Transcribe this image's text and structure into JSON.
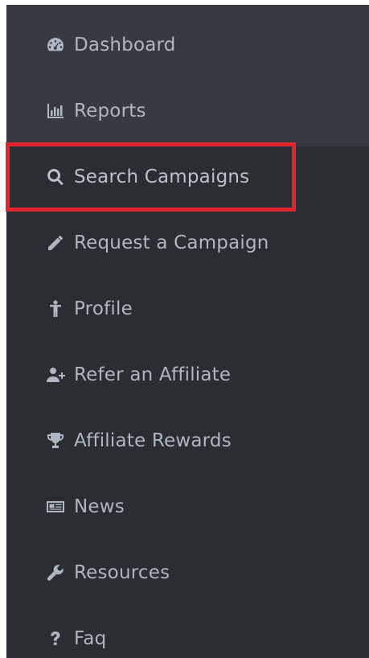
{
  "colors": {
    "sidebar_bg": "#2a2d31",
    "top_block_bg": "#373b41",
    "text": "#aeb7c4",
    "highlight": "#e0262e"
  },
  "nav": {
    "items": [
      {
        "label": "Dashboard",
        "icon": "dashboard-icon"
      },
      {
        "label": "Reports",
        "icon": "bar-chart-icon"
      },
      {
        "label": "Search Campaigns",
        "icon": "search-icon",
        "active": true
      },
      {
        "label": "Request a Campaign",
        "icon": "pencil-icon"
      },
      {
        "label": "Profile",
        "icon": "user-icon"
      },
      {
        "label": "Refer an Affiliate",
        "icon": "user-plus-icon"
      },
      {
        "label": "Affiliate Rewards",
        "icon": "trophy-icon"
      },
      {
        "label": "News",
        "icon": "newspaper-icon"
      },
      {
        "label": "Resources",
        "icon": "wrench-icon"
      },
      {
        "label": "Faq",
        "icon": "question-icon"
      }
    ]
  }
}
